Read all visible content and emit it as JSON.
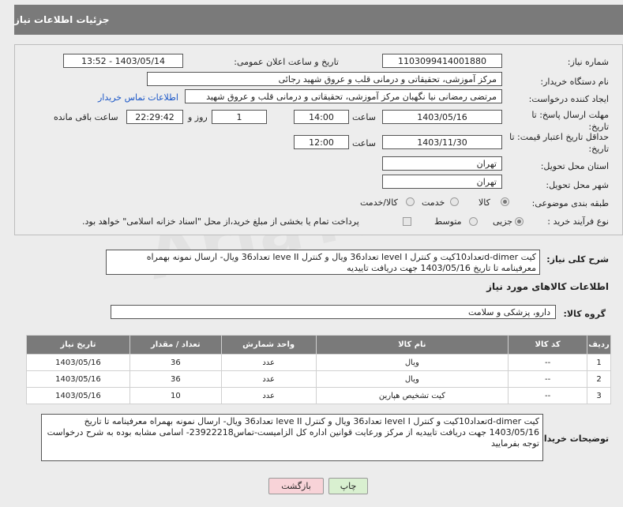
{
  "header": {
    "title": "جزئیات اطلاعات نیاز"
  },
  "form": {
    "need_number_label": "شماره نیاز:",
    "need_number": "1103099414001880",
    "announce_label": "تاریخ و ساعت اعلان عمومی:",
    "announce_value": "1403/05/14 - 13:52",
    "buyer_label": "نام دستگاه خریدار:",
    "buyer_value": "مرکز آموزشی، تحقیقاتی و درمانی قلب و عروق شهید رجائی",
    "creator_label": "ایجاد کننده درخواست:",
    "creator_value": "مرتضی رمضانی نیا نگهبان مرکز آموزشی، تحقیقاتی و درمانی قلب و عروق شهید",
    "contact_link": "اطلاعات تماس خریدار",
    "reply_label": "مهلت ارسال پاسخ: تا تاریخ:",
    "reply_date": "1403/05/16",
    "time_label": "ساعت",
    "reply_time": "14:00",
    "days_value": "1",
    "days_label": "روز و",
    "remain_time": "22:29:42",
    "remain_label": "ساعت باقی مانده",
    "price_label": "حداقل تاریخ اعتبار قیمت: تا تاریخ:",
    "price_date": "1403/11/30",
    "price_time": "12:00",
    "province_label": "استان محل تحویل:",
    "province_value": "تهران",
    "city_label": "شهر محل تحویل:",
    "city_value": "تهران",
    "category_label": "طبقه بندی موضوعی:",
    "category_opts": [
      "کالا",
      "خدمت",
      "کالا/خدمت"
    ],
    "process_label": "نوع فرآیند خرید :",
    "process_opts": [
      "جزیی",
      "متوسط"
    ],
    "payment_note": "پرداخت تمام یا بخشی از مبلغ خرید،از محل \"اسناد خزانه اسلامی\" خواهد بود."
  },
  "summary": {
    "label": "شرح کلی نیاز:",
    "text": "کیت d-dimerتعداد10کیت و کنترل level I تعداد36 ویال و کنترل leve II  تعداد36 ویال- ارسال نمونه  بهمراه معرفینامه تا تاریخ 1403/05/16 جهت دریافت تاییدیه"
  },
  "goods": {
    "section_title": "اطلاعات کالاهای مورد نیاز",
    "group_label": "گروه کالا:",
    "group_value": "دارو، پزشکی و سلامت",
    "columns": [
      "ردیف",
      "کد کالا",
      "نام کالا",
      "واحد شمارش",
      "تعداد / مقدار",
      "تاریخ نیاز"
    ],
    "rows": [
      [
        "1",
        "--",
        "ویال",
        "عدد",
        "36",
        "1403/05/16"
      ],
      [
        "2",
        "--",
        "ویال",
        "عدد",
        "36",
        "1403/05/16"
      ],
      [
        "3",
        "--",
        "کیت تشخیص هپارین",
        "عدد",
        "10",
        "1403/05/16"
      ]
    ]
  },
  "buyer_notes": {
    "label": "توضیحات خریدار:",
    "text": "کیت d-dimerتعداد10کیت و کنترل level I تعداد36 ویال و کنترل leve II  تعداد36 ویال- ارسال نمونه  بهمراه معرفینامه تا تاریخ 1403/05/16 جهت دریافت تاییدیه از مرکز ورعایت قوانین اداره کل الزامیست-تماس23922218- اسامی مشابه بوده به شرح درخواست توجه بفرمایید"
  },
  "buttons": {
    "print": "چاپ",
    "back": "بازگشت"
  },
  "watermark": "AriaTender.neT"
}
